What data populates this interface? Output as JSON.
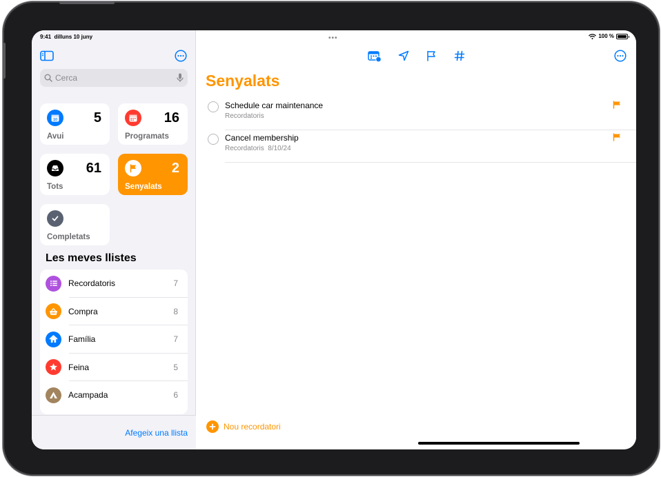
{
  "status": {
    "time": "9:41",
    "date": "dilluns 10 juny",
    "battery": "100 %"
  },
  "sidebar": {
    "search_placeholder": "Cerca",
    "smart_lists": [
      {
        "label": "Avui",
        "count": "5",
        "icon": "calendar-today-icon",
        "color": "#007aff"
      },
      {
        "label": "Programats",
        "count": "16",
        "icon": "calendar-icon",
        "color": "#ff3b30"
      },
      {
        "label": "Tots",
        "count": "61",
        "icon": "tray-icon",
        "color": "#000000"
      },
      {
        "label": "Senyalats",
        "count": "2",
        "icon": "flag-icon",
        "color": "#ff9500",
        "selected": true
      },
      {
        "label": "Completats",
        "count": "",
        "icon": "checkmark-icon",
        "color": "#5a6272"
      }
    ],
    "lists_heading": "Les meves llistes",
    "lists": [
      {
        "name": "Recordatoris",
        "count": "7",
        "icon": "list-icon",
        "color": "#af52de"
      },
      {
        "name": "Compra",
        "count": "8",
        "icon": "basket-icon",
        "color": "#ff9500"
      },
      {
        "name": "Família",
        "count": "7",
        "icon": "house-icon",
        "color": "#007aff"
      },
      {
        "name": "Feina",
        "count": "5",
        "icon": "star-icon",
        "color": "#ff3b30"
      },
      {
        "name": "Acampada",
        "count": "6",
        "icon": "tent-icon",
        "color": "#a2845e"
      }
    ],
    "add_list": "Afegeix una llista"
  },
  "main": {
    "title": "Senyalats",
    "title_color": "#ff9500",
    "reminders": [
      {
        "title": "Schedule car maintenance",
        "list": "Recordatoris",
        "date": ""
      },
      {
        "title": "Cancel membership",
        "list": "Recordatoris",
        "date": "8/10/24"
      }
    ],
    "new_reminder": "Nou recordatori"
  }
}
